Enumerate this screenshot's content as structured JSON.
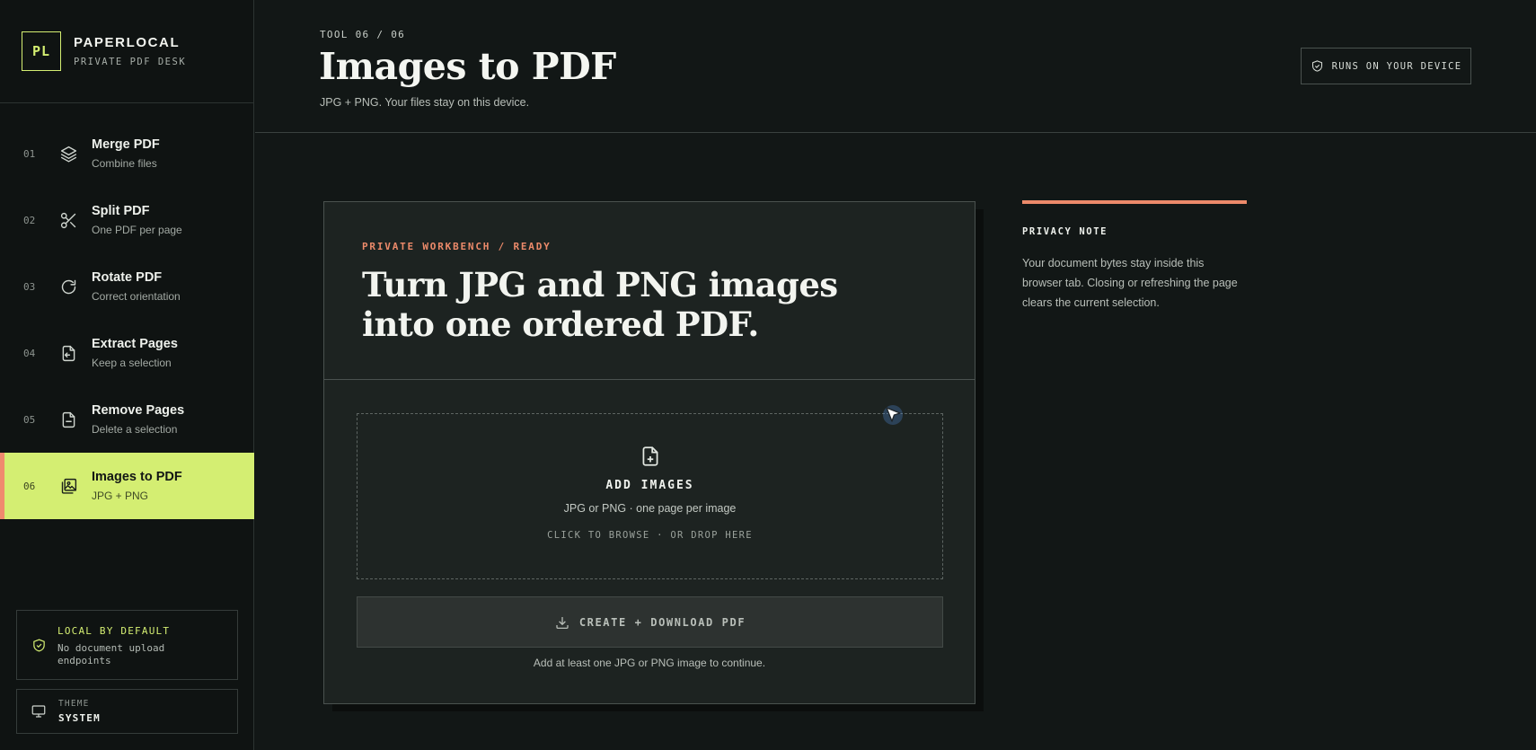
{
  "brand": {
    "logo": "PL",
    "name": "PAPERLOCAL",
    "subtitle": "PRIVATE PDF DESK"
  },
  "nav": [
    {
      "num": "01",
      "title": "Merge PDF",
      "sub": "Combine files",
      "icon": "layers-icon"
    },
    {
      "num": "02",
      "title": "Split PDF",
      "sub": "One PDF per page",
      "icon": "scissors-icon"
    },
    {
      "num": "03",
      "title": "Rotate PDF",
      "sub": "Correct orientation",
      "icon": "rotate-icon"
    },
    {
      "num": "04",
      "title": "Extract Pages",
      "sub": "Keep a selection",
      "icon": "file-export-icon"
    },
    {
      "num": "05",
      "title": "Remove Pages",
      "sub": "Delete a selection",
      "icon": "file-minus-icon"
    },
    {
      "num": "06",
      "title": "Images to PDF",
      "sub": "JPG + PNG",
      "icon": "image-stack-icon",
      "active": true
    }
  ],
  "local_box": {
    "title": "LOCAL BY DEFAULT",
    "sub": "No document upload endpoints"
  },
  "theme": {
    "label": "THEME",
    "value": "SYSTEM"
  },
  "header": {
    "tool_count": "TOOL 06 / 06",
    "title": "Images to PDF",
    "subtitle": "JPG + PNG. Your files stay on this device.",
    "badge": "RUNS ON YOUR DEVICE"
  },
  "card": {
    "eyebrow": "PRIVATE WORKBENCH / READY",
    "heading": "Turn JPG and PNG images into one ordered PDF.",
    "dropzone": {
      "title": "ADD IMAGES",
      "sub": "JPG or PNG · one page per image",
      "hint": "CLICK TO BROWSE · OR DROP HERE"
    },
    "button": "CREATE + DOWNLOAD PDF",
    "helper": "Add at least one JPG or PNG image to continue."
  },
  "privacy": {
    "title": "PRIVACY NOTE",
    "body": "Your document bytes stay inside this browser tab. Closing or refreshing the page clears the current selection."
  },
  "colors": {
    "accent": "#d4ee72",
    "coral": "#ec8a6a",
    "background": "#121716"
  }
}
